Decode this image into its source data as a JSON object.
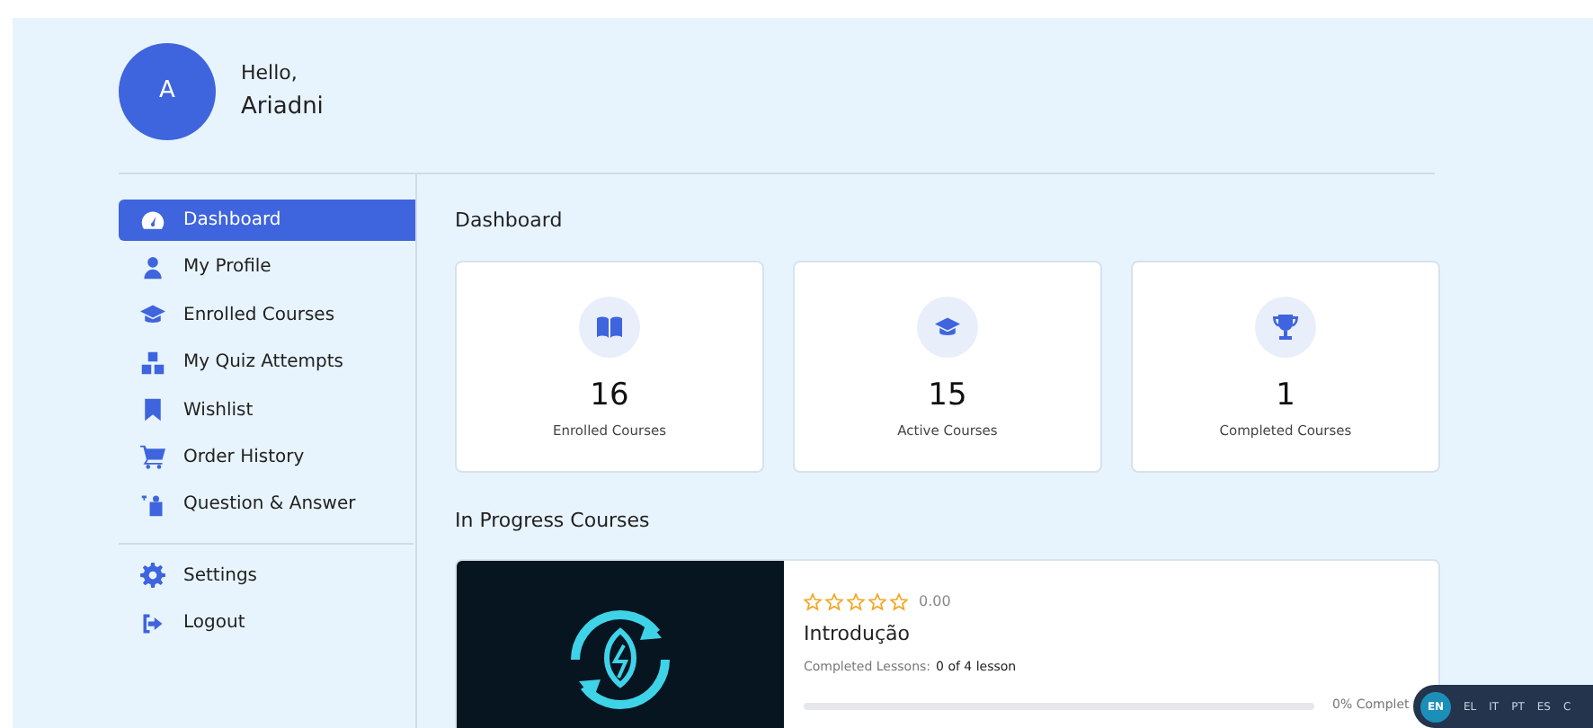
{
  "user": {
    "avatar_letter": "A",
    "greeting": "Hello,",
    "name": "Ariadni"
  },
  "sidebar": {
    "items": [
      {
        "label": "Dashboard",
        "kind": "gauge",
        "selected": true
      },
      {
        "label": "My Profile",
        "kind": "person",
        "selected": false
      },
      {
        "label": "Enrolled Courses",
        "kind": "cap",
        "selected": false
      },
      {
        "label": "My Quiz Attempts",
        "kind": "blocks",
        "selected": false
      },
      {
        "label": "Wishlist",
        "kind": "bookmark",
        "selected": false
      },
      {
        "label": "Order History",
        "kind": "cart",
        "selected": false
      },
      {
        "label": "Question & Answer",
        "kind": "qa",
        "selected": false
      }
    ],
    "bottom_items": [
      {
        "label": "Settings",
        "kind": "gear",
        "selected": false
      },
      {
        "label": "Logout",
        "kind": "logout",
        "selected": false
      }
    ]
  },
  "dashboard": {
    "title": "Dashboard",
    "stats": [
      {
        "kind": "book",
        "value": "16",
        "label": "Enrolled Courses"
      },
      {
        "kind": "cap",
        "value": "15",
        "label": "Active Courses"
      },
      {
        "kind": "trophy",
        "value": "1",
        "label": "Completed Courses"
      }
    ]
  },
  "in_progress": {
    "title": "In Progress Courses",
    "courses": [
      {
        "stars": 0,
        "rating": "0.00",
        "title": "Introdução",
        "lessons_label": "Completed Lessons:",
        "lessons_value": "0 of 4 lesson",
        "level": 0,
        "progress_text": "0% Complet"
      }
    ]
  },
  "languages": [
    {
      "code": "EN",
      "selected": true
    },
    {
      "code": "EL",
      "selected": false
    },
    {
      "code": "IT",
      "selected": false
    },
    {
      "code": "PT",
      "selected": false
    },
    {
      "code": "ES",
      "selected": false
    },
    {
      "code": "C",
      "selected": false
    }
  ]
}
